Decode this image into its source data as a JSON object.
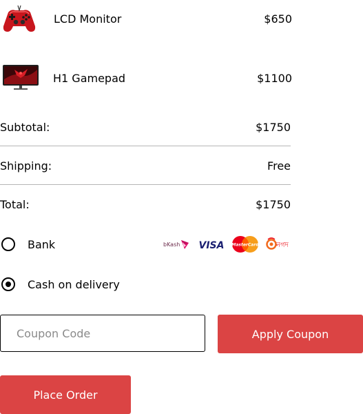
{
  "cart": {
    "items": [
      {
        "name": "LCD Monitor",
        "price": "$650",
        "icon": "gamepad-image"
      },
      {
        "name": "H1 Gamepad",
        "price": "$1100",
        "icon": "monitor-image"
      }
    ]
  },
  "summary": {
    "subtotal_label": "Subtotal:",
    "subtotal_value": "$1750",
    "shipping_label": "Shipping:",
    "shipping_value": "Free",
    "total_label": "Total:",
    "total_value": "$1750"
  },
  "payment": {
    "bank_label": "Bank",
    "cod_label": "Cash on delivery",
    "selected": "cod",
    "logos": {
      "bkash": "bKash",
      "visa": "VISA",
      "mastercard": "MasterCard",
      "nagad": "নগদ"
    }
  },
  "coupon": {
    "placeholder": "Coupon Code",
    "apply_label": "Apply Coupon"
  },
  "order": {
    "place_label": "Place Order"
  },
  "colors": {
    "accent": "#db4444",
    "divider": "#b5b5b5"
  }
}
